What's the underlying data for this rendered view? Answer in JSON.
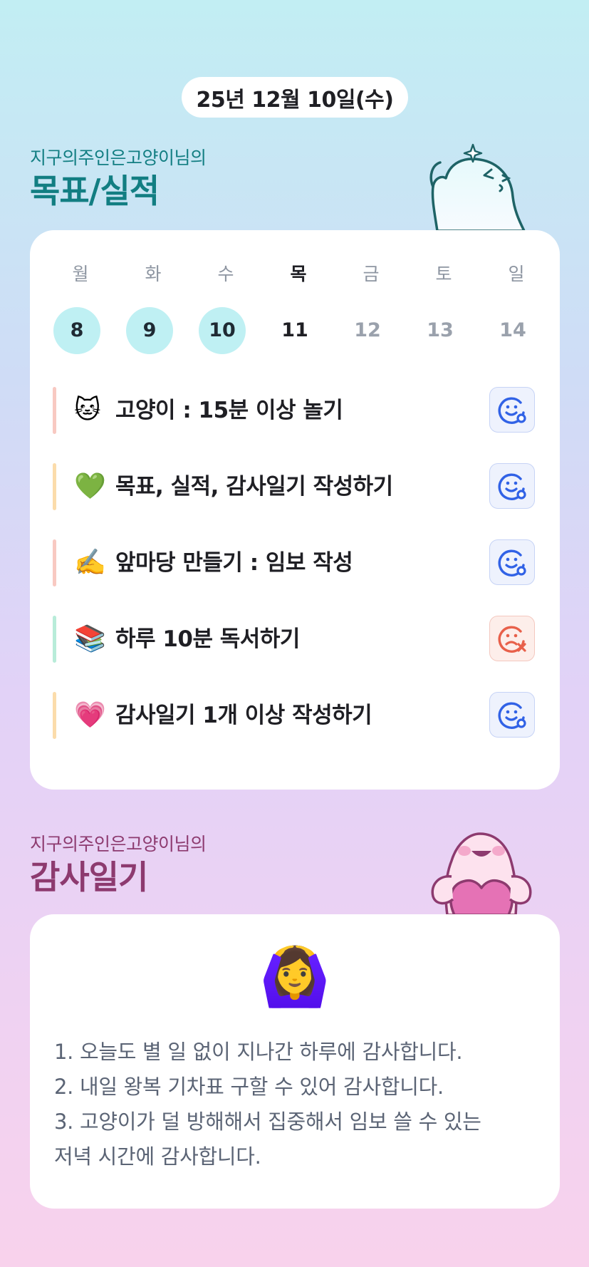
{
  "date_label": "25년 12월 10일(수)",
  "goals_section": {
    "owner_line": "지구의주인은고양이님의",
    "title": "목표/실적"
  },
  "week": {
    "days": [
      {
        "name": "월",
        "num": "8",
        "state": "done"
      },
      {
        "name": "화",
        "num": "9",
        "state": "done"
      },
      {
        "name": "수",
        "num": "10",
        "state": "done"
      },
      {
        "name": "목",
        "num": "11",
        "state": "today"
      },
      {
        "name": "금",
        "num": "12",
        "state": "future"
      },
      {
        "name": "토",
        "num": "13",
        "state": "future"
      },
      {
        "name": "일",
        "num": "14",
        "state": "future"
      }
    ]
  },
  "goals": [
    {
      "emoji": "🐱",
      "text": "고양이 : 15분 이상 놀기",
      "bar_color": "#f8c9c2",
      "status": "achieved",
      "status_icon": "smile-face-icon"
    },
    {
      "emoji": "💚",
      "text": "목표, 실적, 감사일기 작성하기",
      "bar_color": "#fbdcab",
      "status": "achieved",
      "status_icon": "smile-face-icon"
    },
    {
      "emoji": "✍️",
      "text": "앞마당 만들기 : 임보 작성",
      "bar_color": "#f8c9c2",
      "status": "achieved",
      "status_icon": "smile-face-icon"
    },
    {
      "emoji": "📚",
      "text": "하루 10분 독서하기",
      "bar_color": "#b8ecd9",
      "status": "missed",
      "status_icon": "sad-face-x-icon"
    },
    {
      "emoji": "💗",
      "text": "감사일기 1개 이상 작성하기",
      "bar_color": "#fbdcab",
      "status": "achieved",
      "status_icon": "smile-face-icon"
    }
  ],
  "diary_section": {
    "owner_line": "지구의주인은고양이님의",
    "title": "감사일기",
    "emoji": "🙆‍♀️",
    "lines": [
      "1. 오늘도 별 일 없이 지나간 하루에 감사합니다.",
      "2. 내일 왕복 기차표 구할 수 있어 감사합니다.",
      "3. 고양이가 덜 방해해서 집중해서 임보 쓸 수 있는",
      "저녁 시간에 감사합니다."
    ]
  },
  "colors": {
    "accent_teal": "#127e82",
    "accent_plum": "#8d3a6f",
    "achieved_blue": "#3162e6",
    "missed_red": "#e8604a",
    "done_day_bg": "#bff0f3"
  }
}
